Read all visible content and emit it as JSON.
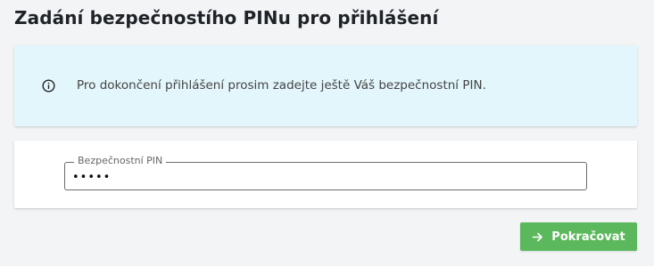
{
  "page": {
    "title": "Zadání bezpečnostího PINu pro přihlášení"
  },
  "info": {
    "icon": "info-icon",
    "message": "Pro dokončení přihlášení prosim zadejte ještě Váš bezpečnostní PIN."
  },
  "pin_field": {
    "label": "Bezpečnostní PIN",
    "value": "•••••"
  },
  "actions": {
    "continue_label": "Pokračovat",
    "continue_icon": "arrow-right-icon"
  },
  "colors": {
    "info_background": "#e2f6fb",
    "button_green": "#5cb85c",
    "page_background": "#f3f4f6"
  }
}
